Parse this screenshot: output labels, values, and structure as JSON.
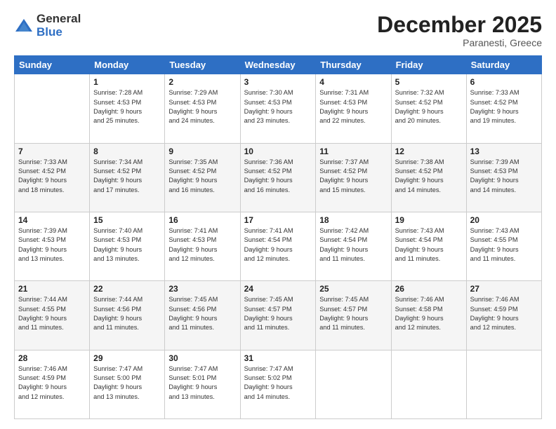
{
  "logo": {
    "general": "General",
    "blue": "Blue"
  },
  "title": "December 2025",
  "location": "Paranesti, Greece",
  "days_of_week": [
    "Sunday",
    "Monday",
    "Tuesday",
    "Wednesday",
    "Thursday",
    "Friday",
    "Saturday"
  ],
  "weeks": [
    [
      {
        "day": "",
        "info": ""
      },
      {
        "day": "1",
        "info": "Sunrise: 7:28 AM\nSunset: 4:53 PM\nDaylight: 9 hours\nand 25 minutes."
      },
      {
        "day": "2",
        "info": "Sunrise: 7:29 AM\nSunset: 4:53 PM\nDaylight: 9 hours\nand 24 minutes."
      },
      {
        "day": "3",
        "info": "Sunrise: 7:30 AM\nSunset: 4:53 PM\nDaylight: 9 hours\nand 23 minutes."
      },
      {
        "day": "4",
        "info": "Sunrise: 7:31 AM\nSunset: 4:53 PM\nDaylight: 9 hours\nand 22 minutes."
      },
      {
        "day": "5",
        "info": "Sunrise: 7:32 AM\nSunset: 4:52 PM\nDaylight: 9 hours\nand 20 minutes."
      },
      {
        "day": "6",
        "info": "Sunrise: 7:33 AM\nSunset: 4:52 PM\nDaylight: 9 hours\nand 19 minutes."
      }
    ],
    [
      {
        "day": "7",
        "info": "Sunrise: 7:33 AM\nSunset: 4:52 PM\nDaylight: 9 hours\nand 18 minutes."
      },
      {
        "day": "8",
        "info": "Sunrise: 7:34 AM\nSunset: 4:52 PM\nDaylight: 9 hours\nand 17 minutes."
      },
      {
        "day": "9",
        "info": "Sunrise: 7:35 AM\nSunset: 4:52 PM\nDaylight: 9 hours\nand 16 minutes."
      },
      {
        "day": "10",
        "info": "Sunrise: 7:36 AM\nSunset: 4:52 PM\nDaylight: 9 hours\nand 16 minutes."
      },
      {
        "day": "11",
        "info": "Sunrise: 7:37 AM\nSunset: 4:52 PM\nDaylight: 9 hours\nand 15 minutes."
      },
      {
        "day": "12",
        "info": "Sunrise: 7:38 AM\nSunset: 4:52 PM\nDaylight: 9 hours\nand 14 minutes."
      },
      {
        "day": "13",
        "info": "Sunrise: 7:39 AM\nSunset: 4:53 PM\nDaylight: 9 hours\nand 14 minutes."
      }
    ],
    [
      {
        "day": "14",
        "info": "Sunrise: 7:39 AM\nSunset: 4:53 PM\nDaylight: 9 hours\nand 13 minutes."
      },
      {
        "day": "15",
        "info": "Sunrise: 7:40 AM\nSunset: 4:53 PM\nDaylight: 9 hours\nand 13 minutes."
      },
      {
        "day": "16",
        "info": "Sunrise: 7:41 AM\nSunset: 4:53 PM\nDaylight: 9 hours\nand 12 minutes."
      },
      {
        "day": "17",
        "info": "Sunrise: 7:41 AM\nSunset: 4:54 PM\nDaylight: 9 hours\nand 12 minutes."
      },
      {
        "day": "18",
        "info": "Sunrise: 7:42 AM\nSunset: 4:54 PM\nDaylight: 9 hours\nand 11 minutes."
      },
      {
        "day": "19",
        "info": "Sunrise: 7:43 AM\nSunset: 4:54 PM\nDaylight: 9 hours\nand 11 minutes."
      },
      {
        "day": "20",
        "info": "Sunrise: 7:43 AM\nSunset: 4:55 PM\nDaylight: 9 hours\nand 11 minutes."
      }
    ],
    [
      {
        "day": "21",
        "info": "Sunrise: 7:44 AM\nSunset: 4:55 PM\nDaylight: 9 hours\nand 11 minutes."
      },
      {
        "day": "22",
        "info": "Sunrise: 7:44 AM\nSunset: 4:56 PM\nDaylight: 9 hours\nand 11 minutes."
      },
      {
        "day": "23",
        "info": "Sunrise: 7:45 AM\nSunset: 4:56 PM\nDaylight: 9 hours\nand 11 minutes."
      },
      {
        "day": "24",
        "info": "Sunrise: 7:45 AM\nSunset: 4:57 PM\nDaylight: 9 hours\nand 11 minutes."
      },
      {
        "day": "25",
        "info": "Sunrise: 7:45 AM\nSunset: 4:57 PM\nDaylight: 9 hours\nand 11 minutes."
      },
      {
        "day": "26",
        "info": "Sunrise: 7:46 AM\nSunset: 4:58 PM\nDaylight: 9 hours\nand 12 minutes."
      },
      {
        "day": "27",
        "info": "Sunrise: 7:46 AM\nSunset: 4:59 PM\nDaylight: 9 hours\nand 12 minutes."
      }
    ],
    [
      {
        "day": "28",
        "info": "Sunrise: 7:46 AM\nSunset: 4:59 PM\nDaylight: 9 hours\nand 12 minutes."
      },
      {
        "day": "29",
        "info": "Sunrise: 7:47 AM\nSunset: 5:00 PM\nDaylight: 9 hours\nand 13 minutes."
      },
      {
        "day": "30",
        "info": "Sunrise: 7:47 AM\nSunset: 5:01 PM\nDaylight: 9 hours\nand 13 minutes."
      },
      {
        "day": "31",
        "info": "Sunrise: 7:47 AM\nSunset: 5:02 PM\nDaylight: 9 hours\nand 14 minutes."
      },
      {
        "day": "",
        "info": ""
      },
      {
        "day": "",
        "info": ""
      },
      {
        "day": "",
        "info": ""
      }
    ]
  ]
}
